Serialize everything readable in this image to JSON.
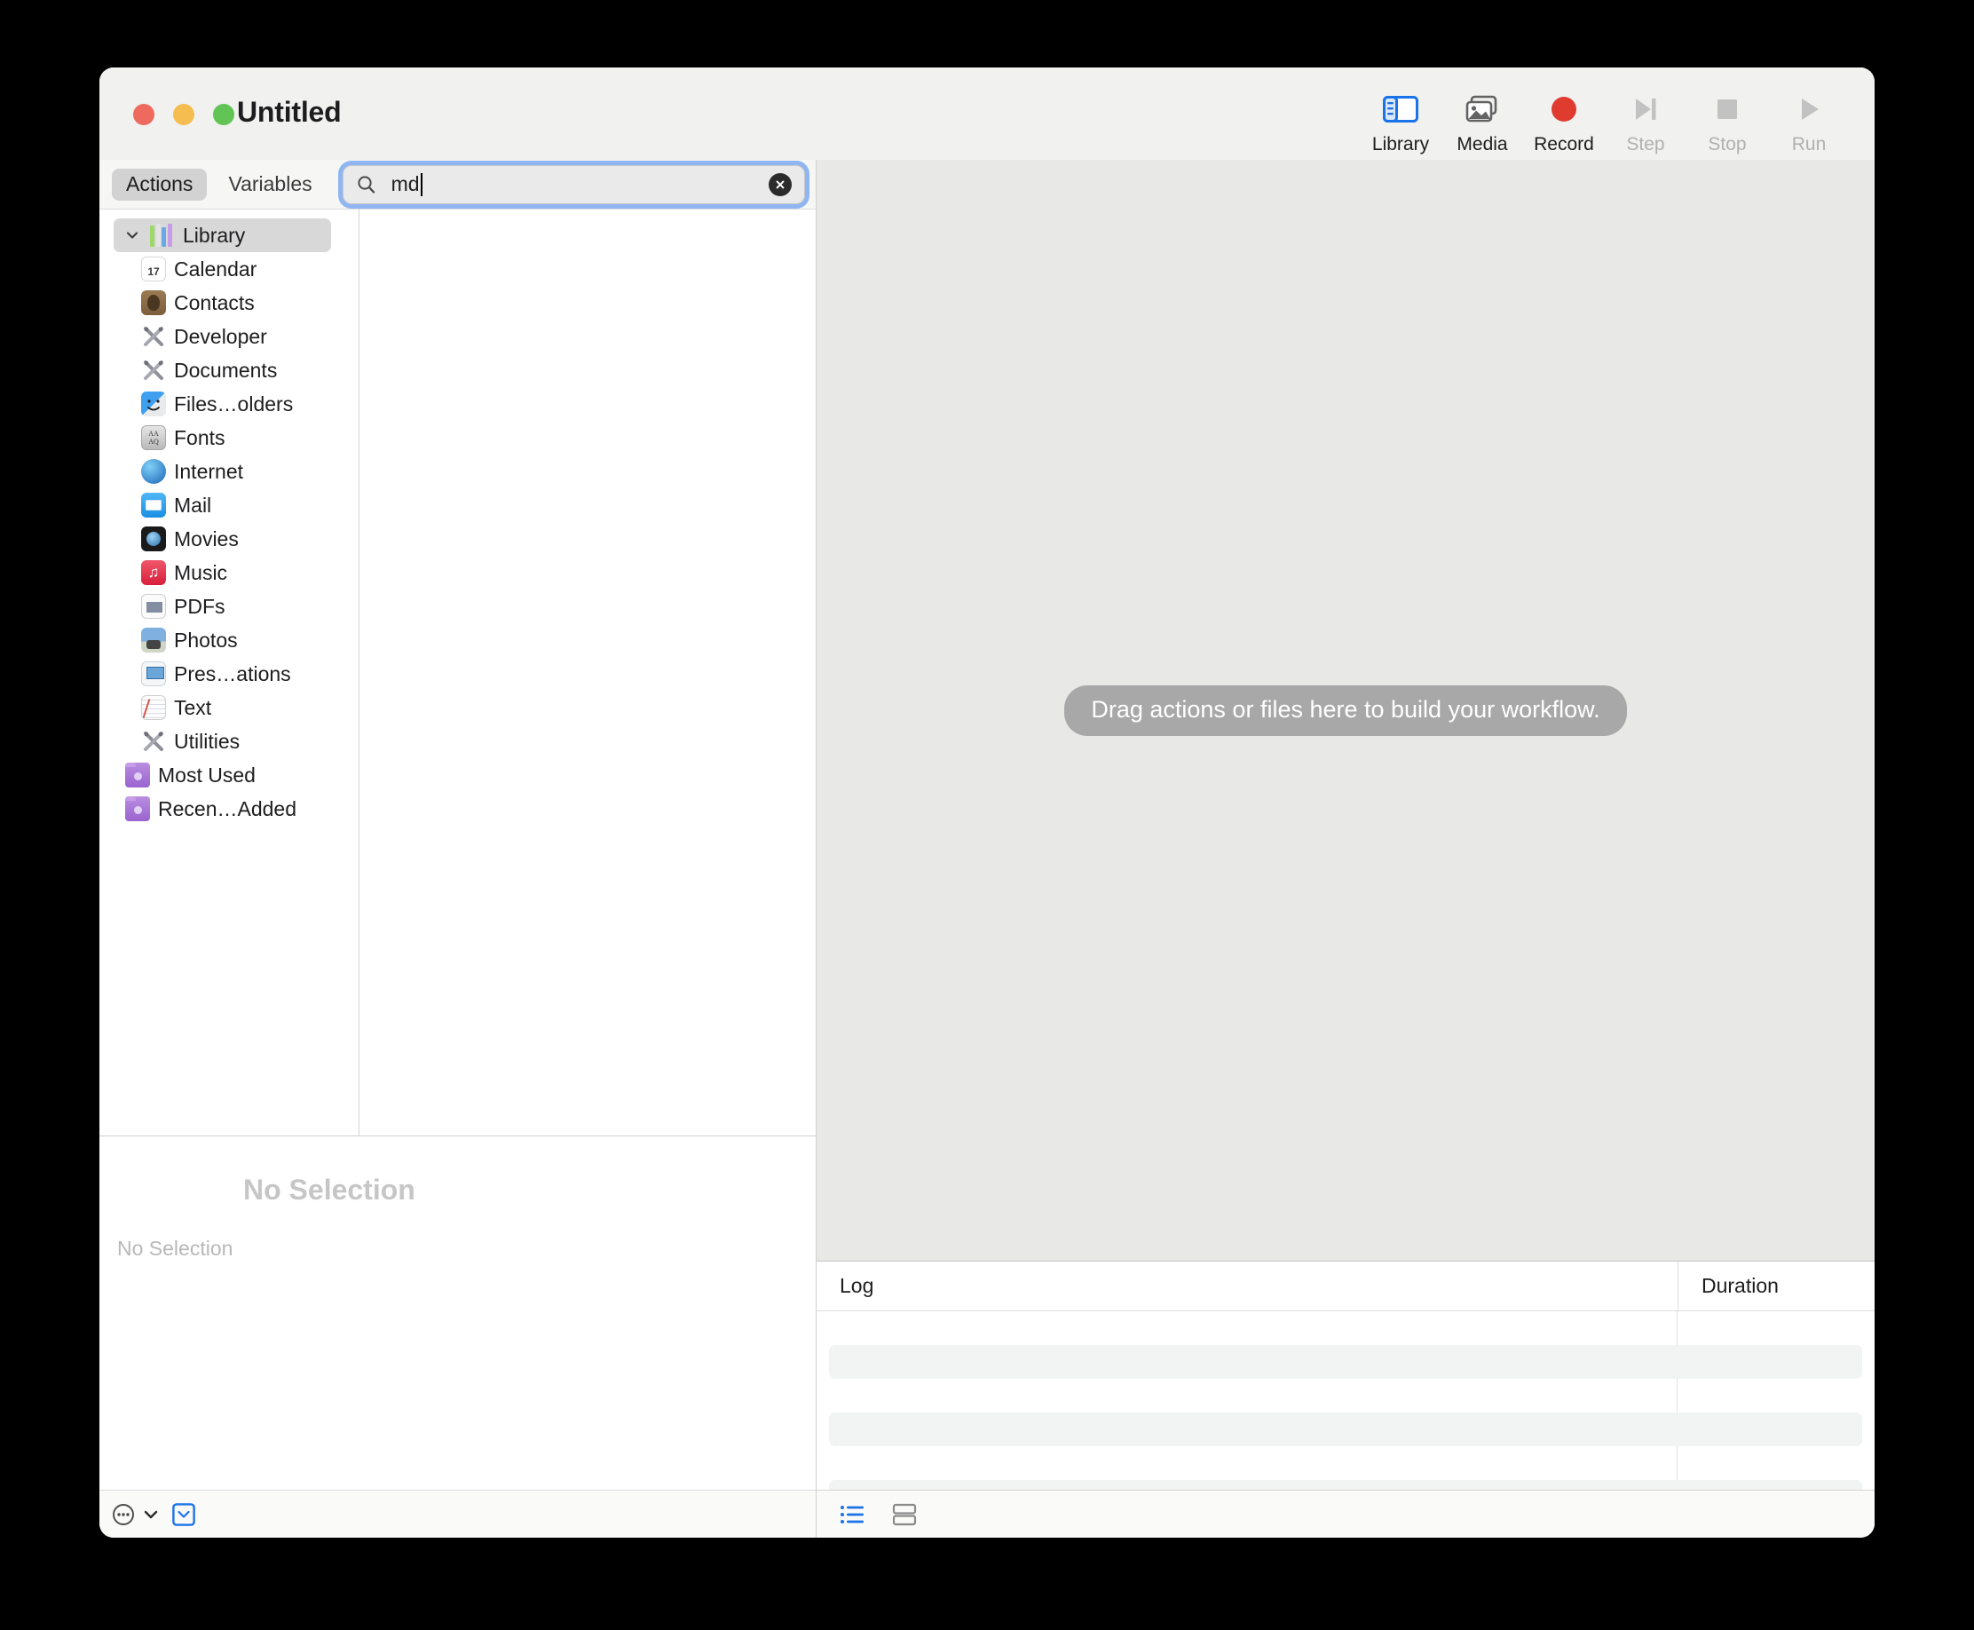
{
  "window": {
    "title": "Untitled",
    "traffic_lights": [
      {
        "name": "close-button",
        "color": "#ee6a5f"
      },
      {
        "name": "minimize-button",
        "color": "#f5bd4f"
      },
      {
        "name": "maximize-button",
        "color": "#61c454"
      }
    ]
  },
  "toolbar": {
    "items": [
      {
        "label": "Library",
        "icon": "sidebar-icon",
        "disabled": false,
        "accent": "#1a73e8"
      },
      {
        "label": "Media",
        "icon": "media-icon",
        "disabled": false,
        "accent": "#636363"
      },
      {
        "label": "Record",
        "icon": "record-dot-icon",
        "disabled": false,
        "accent": "#e03b2f"
      },
      {
        "label": "Step",
        "icon": "step-forward-icon",
        "disabled": true,
        "accent": "#c2c2c2"
      },
      {
        "label": "Stop",
        "icon": "stop-square-icon",
        "disabled": true,
        "accent": "#c2c2c2"
      },
      {
        "label": "Run",
        "icon": "play-icon",
        "disabled": true,
        "accent": "#c2c2c2"
      }
    ]
  },
  "library": {
    "tabs": [
      {
        "label": "Actions",
        "active": true
      },
      {
        "label": "Variables",
        "active": false
      }
    ],
    "search": {
      "value": "md",
      "placeholder": "Search",
      "icon": "search-icon",
      "clear_icon": "clear-circle-icon",
      "focused": true
    },
    "tree": [
      {
        "label": "Library",
        "icon": "library-icon",
        "level": 0,
        "selected": true,
        "expanded": true,
        "disclosure": "chevron-down-icon"
      },
      {
        "label": "Calendar",
        "icon": "calendar-icon",
        "level": 1,
        "selected": false
      },
      {
        "label": "Contacts",
        "icon": "contacts-icon",
        "level": 1,
        "selected": false
      },
      {
        "label": "Developer",
        "icon": "tools-icon",
        "level": 1,
        "selected": false
      },
      {
        "label": "Documents",
        "icon": "tools-icon",
        "level": 1,
        "selected": false
      },
      {
        "label": "Files…olders",
        "icon": "finder-icon",
        "level": 1,
        "selected": false
      },
      {
        "label": "Fonts",
        "icon": "fonts-icon",
        "level": 1,
        "selected": false
      },
      {
        "label": "Internet",
        "icon": "globe-icon",
        "level": 1,
        "selected": false
      },
      {
        "label": "Mail",
        "icon": "mail-icon",
        "level": 1,
        "selected": false
      },
      {
        "label": "Movies",
        "icon": "quicktime-icon",
        "level": 1,
        "selected": false
      },
      {
        "label": "Music",
        "icon": "music-icon",
        "level": 1,
        "selected": false
      },
      {
        "label": "PDFs",
        "icon": "pdf-icon",
        "level": 1,
        "selected": false
      },
      {
        "label": "Photos",
        "icon": "photos-icon",
        "level": 1,
        "selected": false
      },
      {
        "label": "Pres…ations",
        "icon": "keynote-icon",
        "level": 1,
        "selected": false
      },
      {
        "label": "Text",
        "icon": "textedit-icon",
        "level": 1,
        "selected": false
      },
      {
        "label": "Utilities",
        "icon": "tools-icon",
        "level": 1,
        "selected": false
      },
      {
        "label": "Most Used",
        "icon": "smart-folder-icon",
        "level": 0,
        "selected": false
      },
      {
        "label": "Recen…Added",
        "icon": "smart-folder-icon",
        "level": 0,
        "selected": false
      }
    ],
    "actions_list": {
      "items": []
    },
    "description": {
      "title": "No Selection",
      "subtitle": "No Selection"
    },
    "bottom_bar": [
      {
        "name": "action-menu-button",
        "icon": "ellipsis-circle-icon"
      },
      {
        "name": "action-menu-chevron",
        "icon": "chevron-down-icon"
      },
      {
        "name": "toggle-description-button",
        "icon": "chevron-down-box-icon",
        "accent": "#1a73e8"
      }
    ]
  },
  "canvas": {
    "drop_hint": "Drag actions or files here to build your workflow.",
    "background": "#e8e8e7"
  },
  "log": {
    "columns": [
      {
        "label": "Log"
      },
      {
        "label": "Duration"
      }
    ],
    "rows": [],
    "bottom_bar": [
      {
        "name": "log-list-view-button",
        "icon": "list-view-icon",
        "active": true,
        "accent": "#1a73e8"
      },
      {
        "name": "log-split-view-button",
        "icon": "split-view-icon",
        "active": false,
        "accent": "#8a8a8a"
      }
    ]
  }
}
